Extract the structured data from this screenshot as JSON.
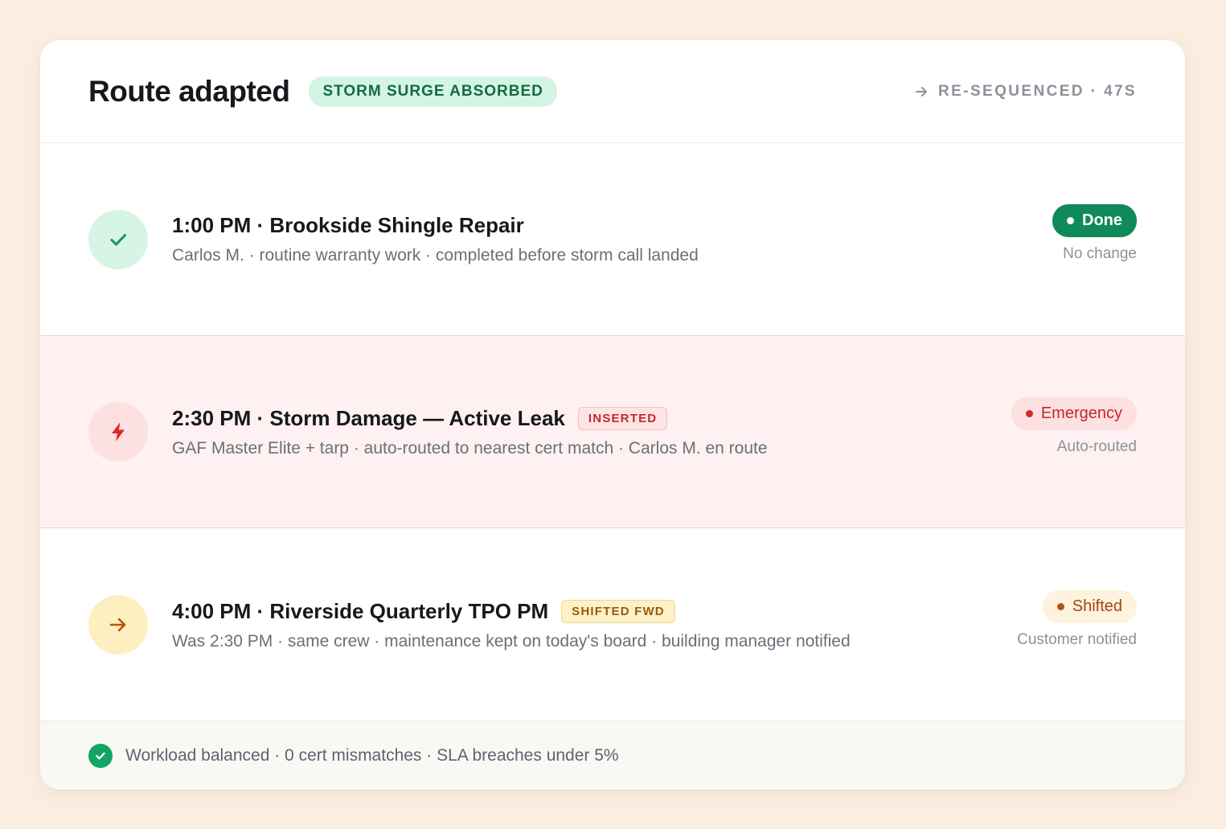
{
  "header": {
    "title": "Route adapted",
    "badge": "STORM SURGE ABSORBED",
    "resequenced": "RE-SEQUENCED · 47S",
    "resequenced_icon": "arrow-right-icon"
  },
  "rows": [
    {
      "icon": "check-icon",
      "title": "1:00 PM · Brookside Shingle Repair",
      "subtitle": "Carlos M. · routine warranty work · completed before storm call landed",
      "tag": "",
      "status": "Done",
      "note": "No change"
    },
    {
      "icon": "lightning-icon",
      "title": "2:30 PM · Storm Damage — Active Leak",
      "subtitle": "GAF Master Elite + tarp · auto-routed to nearest cert match · Carlos M. en route",
      "tag": "INSERTED",
      "status": "Emergency",
      "note": "Auto-routed"
    },
    {
      "icon": "arrow-right-icon",
      "title": "4:00 PM · Riverside Quarterly TPO PM",
      "subtitle": "Was 2:30 PM · same crew · maintenance kept on today's board · building manager notified",
      "tag": "SHIFTED FWD",
      "status": "Shifted",
      "note": "Customer notified"
    }
  ],
  "footer": {
    "icon": "check-circle-icon",
    "text": "Workload balanced · 0 cert mismatches · SLA breaches under 5%"
  },
  "colors": {
    "success": "#0f8a58",
    "emergency": "#c3282a",
    "shifted": "#a1470b",
    "background": "#fbeee1"
  }
}
